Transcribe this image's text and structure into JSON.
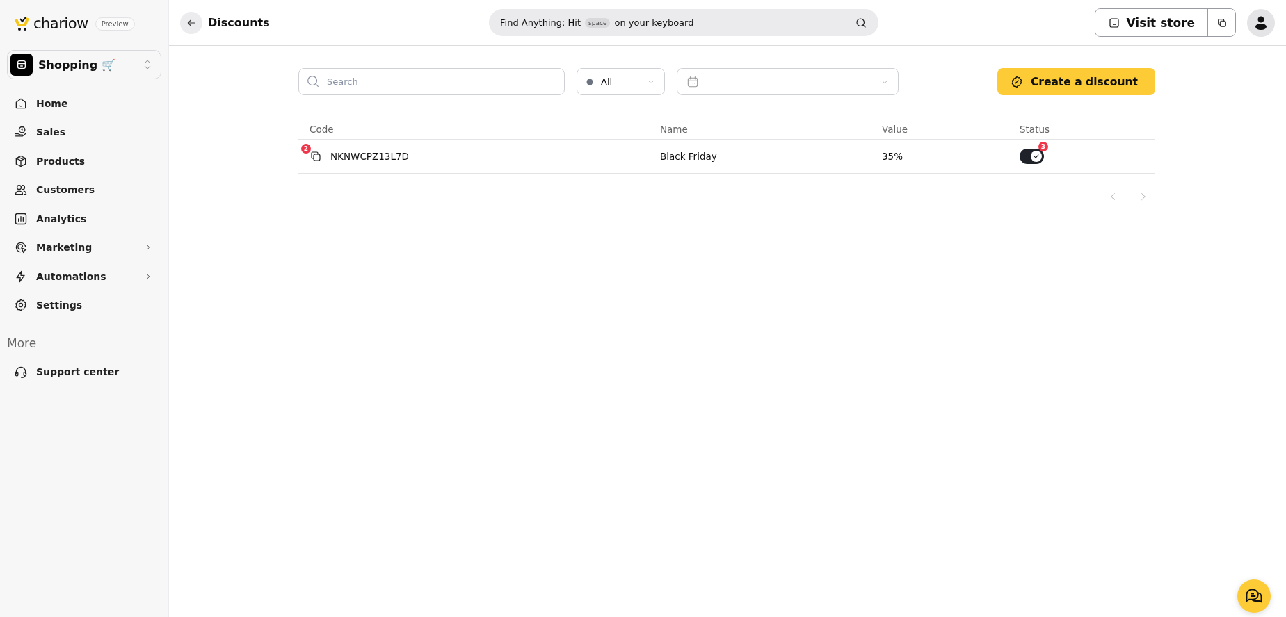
{
  "sidebar": {
    "brand": "chariow",
    "badge": "Preview",
    "store": {
      "name": "Shopping 🛒"
    },
    "items": [
      {
        "label": "Home",
        "has_submenu": false
      },
      {
        "label": "Sales",
        "has_submenu": false
      },
      {
        "label": "Products",
        "has_submenu": false
      },
      {
        "label": "Customers",
        "has_submenu": false
      },
      {
        "label": "Analytics",
        "has_submenu": false
      },
      {
        "label": "Marketing",
        "has_submenu": true
      },
      {
        "label": "Automations",
        "has_submenu": true
      },
      {
        "label": "Settings",
        "has_submenu": false
      }
    ],
    "section_title": "More",
    "more_items": [
      {
        "label": "Support center"
      }
    ]
  },
  "header": {
    "title": "Discounts",
    "search": {
      "before": "Find Anything: Hit",
      "key": "space",
      "after": "on your keyboard"
    },
    "visit_store": "Visit store"
  },
  "filters": {
    "search": {
      "placeholder": "Search"
    },
    "status": {
      "value": "All"
    },
    "create_button": "Create a discount"
  },
  "table": {
    "columns": [
      "Code",
      "Name",
      "Value",
      "Status"
    ],
    "rows": [
      {
        "code": "NKNWCPZ13L7D",
        "code_badge": "2",
        "name": "Black Friday",
        "value": "35%",
        "status_on": true,
        "status_badge": "3"
      }
    ]
  }
}
